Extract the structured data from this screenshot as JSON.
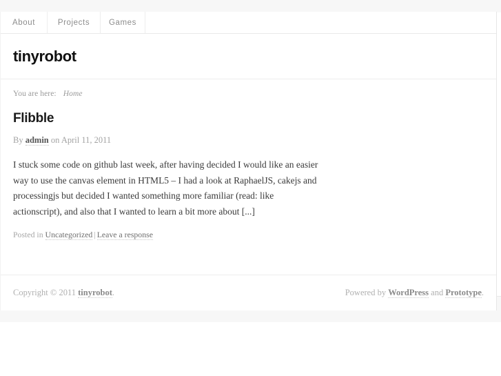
{
  "nav": {
    "items": [
      {
        "label": "About"
      },
      {
        "label": "Projects"
      },
      {
        "label": "Games"
      }
    ]
  },
  "branding": {
    "site_title": "tinyrobot"
  },
  "breadcrumb": {
    "prefix": "You are here:",
    "current": "Home"
  },
  "post": {
    "title": "Flibble",
    "meta_by": "By",
    "meta_author": "admin",
    "meta_on": "on",
    "meta_date": "April 11, 2011",
    "excerpt": "I stuck some code on github last week, after having decided I would like an easier way to use the canvas element in HTML5 – I had a look at RaphaelJS, cakejs and processingjs but decided I wanted something more familiar (read: like actionscript), and also that I wanted to learn a bit more about [...]",
    "posted_in_label": "Posted in",
    "category": "Uncategorized",
    "separator": "|",
    "comment_link": "Leave a response"
  },
  "footer": {
    "copyright_prefix": "Copyright © 2011",
    "copyright_site": "tinyrobot",
    "copyright_suffix": ".",
    "powered_prefix": "Powered by",
    "platform": "WordPress",
    "and": "and",
    "theme": "Prototype",
    "powered_suffix": "."
  },
  "colors": {
    "page_background": "#ffffff",
    "strip_background": "#f7f7f7",
    "border": "#e9e9e9",
    "text": "#3a3a3a",
    "muted_text": "#a6a6a6"
  }
}
